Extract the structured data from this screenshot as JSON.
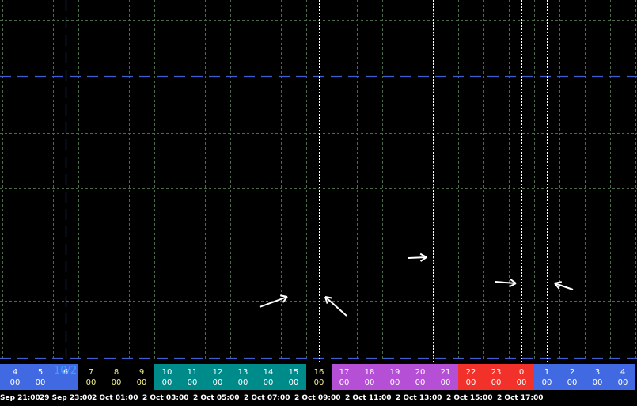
{
  "session_bar": {
    "day_label": "10/2",
    "colors": {
      "blue": "#4169e1",
      "teal": "#008b8b",
      "purple": "#b44fd6",
      "red": "#f2322a",
      "grid": "#4a6a4a",
      "blue_line": "#3f5fd0",
      "white_line": "#ffffff"
    },
    "hours": [
      {
        "h": "4",
        "m": "00",
        "color": "blue"
      },
      {
        "h": "5",
        "m": "00",
        "color": "blue"
      },
      {
        "h": "6",
        "m": "",
        "color": "blue"
      },
      {
        "h": "7",
        "m": "00",
        "color": "black",
        "yellow": true
      },
      {
        "h": "8",
        "m": "00",
        "color": "black",
        "yellow": true
      },
      {
        "h": "9",
        "m": "00",
        "color": "black",
        "yellow": true
      },
      {
        "h": "10",
        "m": "00",
        "color": "teal"
      },
      {
        "h": "11",
        "m": "00",
        "color": "teal"
      },
      {
        "h": "12",
        "m": "00",
        "color": "teal"
      },
      {
        "h": "13",
        "m": "00",
        "color": "teal"
      },
      {
        "h": "14",
        "m": "00",
        "color": "teal"
      },
      {
        "h": "15",
        "m": "00",
        "color": "teal"
      },
      {
        "h": "16",
        "m": "00",
        "color": "black",
        "yellow": true
      },
      {
        "h": "17",
        "m": "00",
        "color": "purple"
      },
      {
        "h": "18",
        "m": "00",
        "color": "purple"
      },
      {
        "h": "19",
        "m": "00",
        "color": "purple"
      },
      {
        "h": "20",
        "m": "00",
        "color": "purple"
      },
      {
        "h": "21",
        "m": "00",
        "color": "purple"
      },
      {
        "h": "22",
        "m": "00",
        "color": "red"
      },
      {
        "h": "23",
        "m": "00",
        "color": "red"
      },
      {
        "h": "0",
        "m": "00",
        "color": "red"
      },
      {
        "h": "1",
        "m": "00",
        "color": "blue"
      },
      {
        "h": "2",
        "m": "00",
        "color": "blue"
      },
      {
        "h": "3",
        "m": "00",
        "color": "blue"
      },
      {
        "h": "4",
        "m": "00",
        "color": "blue"
      }
    ]
  },
  "time_axis": {
    "labels": [
      "Sep 21:00",
      "29 Sep 23:00",
      "2 Oct 01:00",
      "2 Oct 03:00",
      "2 Oct 05:00",
      "2 Oct 07:00",
      "2 Oct 09:00",
      "2 Oct 11:00",
      "2 Oct 13:00",
      "2 Oct 15:00",
      "2 Oct 17:00"
    ]
  }
}
